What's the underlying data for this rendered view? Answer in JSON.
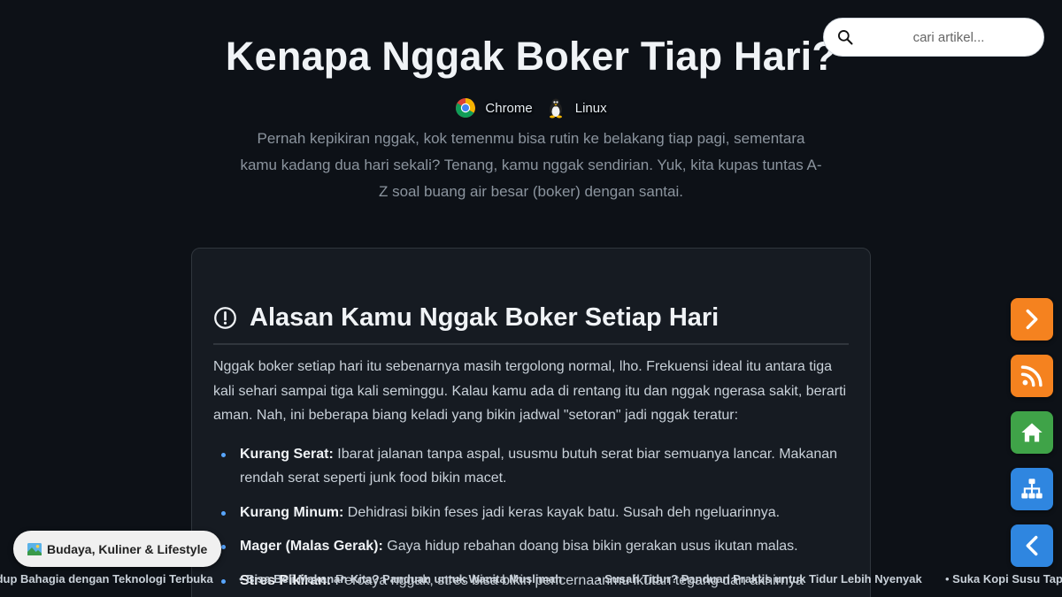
{
  "article": {
    "title": "Kenapa Nggak Boker Tiap Hari?",
    "platforms": [
      {
        "label": "Chrome",
        "icon": "chrome-icon"
      },
      {
        "label": "Linux",
        "icon": "linux-tux-icon"
      }
    ],
    "intro": "Pernah kepikiran nggak, kok temenmu bisa rutin ke belakang tiap pagi, sementara kamu kadang dua hari sekali? Tenang, kamu nggak sendirian. Yuk, kita kupas tuntas A-Z soal buang air besar (boker) dengan santai."
  },
  "search": {
    "placeholder": "cari artikel...",
    "icon": "search-icon"
  },
  "section": {
    "icon": "alert-circle-icon",
    "title": "Alasan Kamu Nggak Boker Setiap Hari",
    "paragraph": "Nggak boker setiap hari itu sebenarnya masih tergolong normal, lho. Frekuensi ideal itu antara tiga kali sehari sampai tiga kali seminggu. Kalau kamu ada di rentang itu dan nggak ngerasa sakit, berarti aman. Nah, ini beberapa biang keladi yang bikin jadwal \"setoran\" jadi nggak teratur:",
    "reasons": [
      {
        "term": "Kurang Serat:",
        "text": " Ibarat jalanan tanpa aspal, ususmu butuh serat biar semuanya lancar. Makanan rendah serat seperti junk food bikin macet."
      },
      {
        "term": "Kurang Minum:",
        "text": " Dehidrasi bikin feses jadi keras kayak batu. Susah deh ngeluarinnya."
      },
      {
        "term": "Mager (Malas Gerak):",
        "text": " Gaya hidup rebahan doang bisa bikin gerakan usus ikutan malas."
      },
      {
        "term": "Stres Pikiran:",
        "text": " Percaya nggak, stres bisa bikin pencernaanmu ikutan tegang dan akhirnya"
      }
    ]
  },
  "side_nav": [
    {
      "name": "next-button",
      "icon": "chevron-right-icon",
      "color": "#f5821f"
    },
    {
      "name": "rss-button",
      "icon": "rss-icon",
      "color": "#f5821f"
    },
    {
      "name": "home-button",
      "icon": "home-icon",
      "color": "#3fa348"
    },
    {
      "name": "sitemap-button",
      "icon": "sitemap-icon",
      "color": "#2f86e0"
    },
    {
      "name": "prev-button",
      "icon": "chevron-left-icon",
      "color": "#2f86e0"
    }
  ],
  "category": {
    "icon": "landscape-picture-icon",
    "label": "Budaya, Kuliner & Lifestyle"
  },
  "ticker": {
    "items": [
      "idup Bahagia dengan Teknologi Terbuka",
      "Bisa Beli Makanan Kita? Panduan untuk Wanita Muslimah",
      "Susah Tidur? Panduan Praktis untuk Tidur Lebih Nyenyak",
      "Suka Kopi Susu Tap"
    ]
  },
  "colors": {
    "background": "#0d1117",
    "card": "#161b22",
    "accent_orange": "#f5821f",
    "accent_green": "#3fa348",
    "accent_blue": "#2f86e0"
  }
}
